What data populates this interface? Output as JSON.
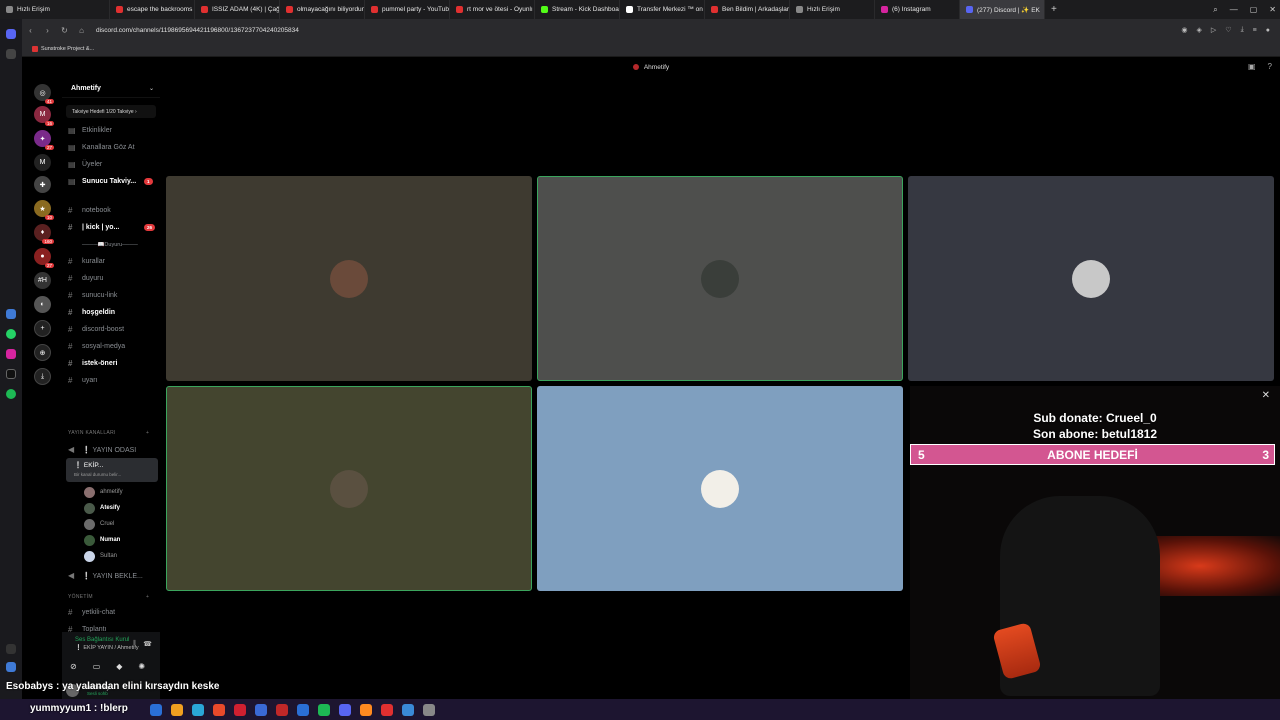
{
  "browser": {
    "tabs": [
      {
        "label": "Hızlı Erişim",
        "color": "#888888",
        "active": false
      },
      {
        "label": "escape the backrooms - Y",
        "color": "#e03030",
        "active": false
      },
      {
        "label": "ISSIZ ADAM (4K) | Çağan",
        "color": "#e03030",
        "active": false
      },
      {
        "label": "olmayacağını biliyordun y",
        "color": "#e03030",
        "active": false
      },
      {
        "label": "pummel party - YouTube",
        "color": "#e03030",
        "active": false
      },
      {
        "label": "rt mor ve ötesi - Oyunlı",
        "color": "#e03030",
        "active": false
      },
      {
        "label": "Stream - Kick Dashboard",
        "color": "#53fc18",
        "active": false
      },
      {
        "label": "Transfer Merkezi ™ on X",
        "color": "#ffffff",
        "active": false
      },
      {
        "label": "Ben Bildim | Arkadaşlarınl",
        "color": "#e03030",
        "active": false
      },
      {
        "label": "Hızlı Erişim",
        "color": "#888888",
        "active": false
      },
      {
        "label": "(6) Instagram",
        "color": "#d6249f",
        "active": false
      },
      {
        "label": "(277) Discord | ✨ EK",
        "color": "#5865f2",
        "active": true
      }
    ],
    "url": "discord.com/channels/1198695694421196800/1367237704240205834",
    "bookmark": "Sunstroke Project &..."
  },
  "discord": {
    "window_title": "Ahmetify",
    "server_name": "Ahmetify",
    "boost_label": "Takviye Hedefi 1/20 Takviye ›",
    "top_items": [
      {
        "label": "Etkinlikler"
      },
      {
        "label": "Kanallara Göz At"
      },
      {
        "label": "Üyeler"
      },
      {
        "label": "Sunucu Takviy...",
        "count": "1"
      }
    ],
    "channels": [
      {
        "label": "notebook",
        "bold": false
      },
      {
        "label": "| kick | yo...",
        "bold": true,
        "count": "26"
      },
      {
        "label": "────📖Duyuru────",
        "bold": false,
        "category": true
      },
      {
        "label": "kurallar",
        "bold": false
      },
      {
        "label": "duyuru",
        "bold": false
      },
      {
        "label": "sunucu-link",
        "bold": false
      },
      {
        "label": "hoşgeldin",
        "bold": true
      },
      {
        "label": "discord-boost",
        "bold": false
      },
      {
        "label": "sosyal-medya",
        "bold": false
      },
      {
        "label": "istek-öneri",
        "bold": true
      },
      {
        "label": "uyarı",
        "bold": false
      }
    ],
    "category_stream": "YAYIN KANALLARI",
    "voice_channel_1": "❕ YAYIN ODASI",
    "active_voice": {
      "name": "❕ EKİP...",
      "sub": "Bir kanal durumu belir..."
    },
    "voice_users": [
      {
        "name": "ahmetify",
        "on": false,
        "color": "#8a6f6f"
      },
      {
        "name": "Atesify",
        "on": true,
        "color": "#4a5a4a"
      },
      {
        "name": "Cruel",
        "on": false,
        "color": "#6b6b6b"
      },
      {
        "name": "Numan",
        "on": true,
        "color": "#3a5a3a"
      },
      {
        "name": "Sultan",
        "on": false,
        "color": "#c9d4e8"
      }
    ],
    "voice_channel_wait": "❕ YAYIN BEKLE...",
    "category_manage": "YÖNETİM",
    "manage_channels": [
      {
        "label": "yetkili-chat"
      },
      {
        "label": "Toplantı"
      }
    ],
    "voice_status": "Ses Bağlantısı Kurul",
    "voice_status_sub": "❕ EKİP YAYIN / Ahmetify",
    "me": {
      "name": "ahmetify",
      "status": "Sesli sohb"
    }
  },
  "tiles": [
    {
      "bg": "#3e3a30",
      "avatar": "#6a4a3a",
      "name": "tile-user-1"
    },
    {
      "bg": "#4e4f4d",
      "avatar": "#3a3e3a",
      "name": "tile-user-2",
      "speaking": true
    },
    {
      "bg": "#363841",
      "avatar": "#c8c8c8",
      "name": "tile-user-3"
    },
    {
      "bg": "#44452f",
      "avatar": "#5a5040",
      "name": "tile-user-4",
      "speaking": true
    },
    {
      "bg": "#7f9fbf",
      "avatar": "#f2efe8",
      "name": "tile-user-5"
    }
  ],
  "overlay": {
    "sub_donate": "Sub donate: Crueel_0",
    "last_sub": "Son abone: betul1812",
    "goal_left": "5",
    "goal_title": "ABONE HEDEFİ",
    "goal_right": "3",
    "close": "✕"
  },
  "chat": {
    "line1": "Esobabys : ya yalandan elini kırsaydın keske",
    "line2": "yummyyum1 : !blerp"
  },
  "colors": {
    "discord_bg": "#000000",
    "goal_pink": "#d35691",
    "online_green": "#23a55a",
    "badge_red": "#e3393c"
  }
}
